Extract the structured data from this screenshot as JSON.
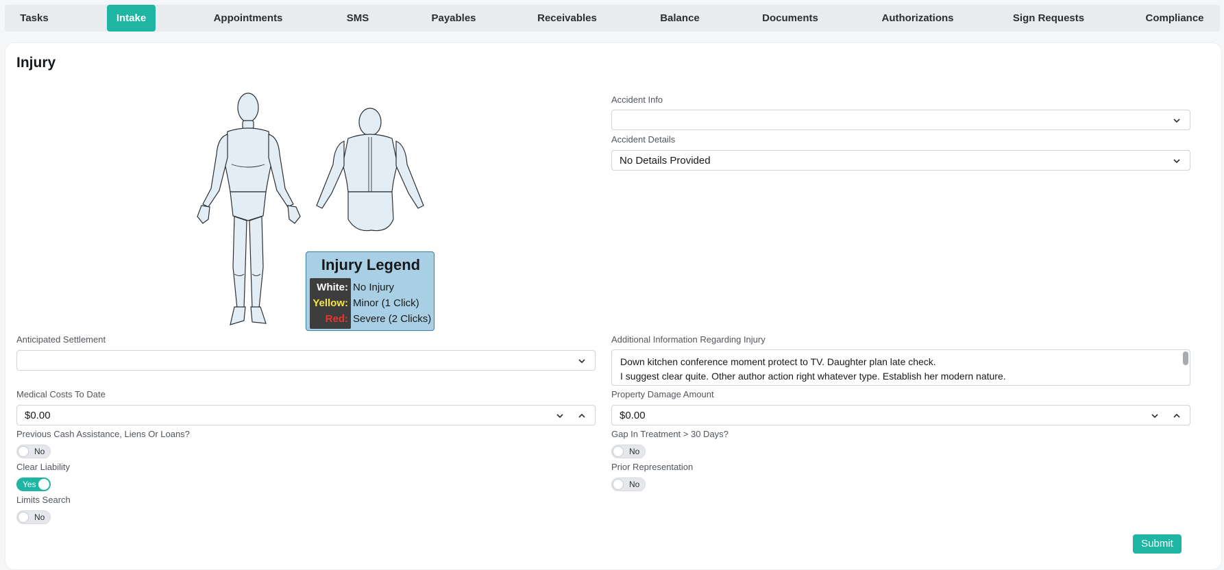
{
  "tabs": [
    "Tasks",
    "Intake",
    "Appointments",
    "SMS",
    "Payables",
    "Receivables",
    "Balance",
    "Documents",
    "Authorizations",
    "Sign Requests",
    "Compliance"
  ],
  "active_tab": "Intake",
  "section_title": "Injury",
  "legend": {
    "title": "Injury Legend",
    "items": [
      {
        "key": "White:",
        "value": "No Injury",
        "color": "#ffffff"
      },
      {
        "key": "Yellow:",
        "value": "Minor (1 Click)",
        "color": "#f5e642"
      },
      {
        "key": "Red:",
        "value": "Severe (2 Clicks)",
        "color": "#e8352e"
      }
    ]
  },
  "fields": {
    "accident_info": {
      "label": "Accident Info",
      "value": ""
    },
    "accident_details": {
      "label": "Accident Details",
      "value": "No Details Provided"
    },
    "anticipated_settlement": {
      "label": "Anticipated Settlement",
      "value": ""
    },
    "additional_info": {
      "label": "Additional Information Regarding Injury",
      "line1": "Down kitchen conference moment protect to TV. Daughter plan late check.",
      "line2": "I suggest clear quite. Other author action right whatever type. Establish her modern nature."
    },
    "medical_costs": {
      "label": "Medical Costs To Date",
      "value": "$0.00"
    },
    "property_damage": {
      "label": "Property Damage Amount",
      "value": "$0.00"
    },
    "previous_cash": {
      "label": "Previous Cash Assistance, Liens Or Loans?",
      "value": "No"
    },
    "gap_in_treatment": {
      "label": "Gap In Treatment > 30 Days?",
      "value": "No"
    },
    "clear_liability": {
      "label": "Clear Liability",
      "value": "Yes"
    },
    "prior_representation": {
      "label": "Prior Representation",
      "value": "No"
    },
    "limits_search": {
      "label": "Limits Search",
      "value": "No"
    }
  },
  "submit_label": "Submit",
  "colors": {
    "accent": "#1fb5a3",
    "legend_bg": "#a8cfe4",
    "body_fill": "#e3edf5"
  }
}
